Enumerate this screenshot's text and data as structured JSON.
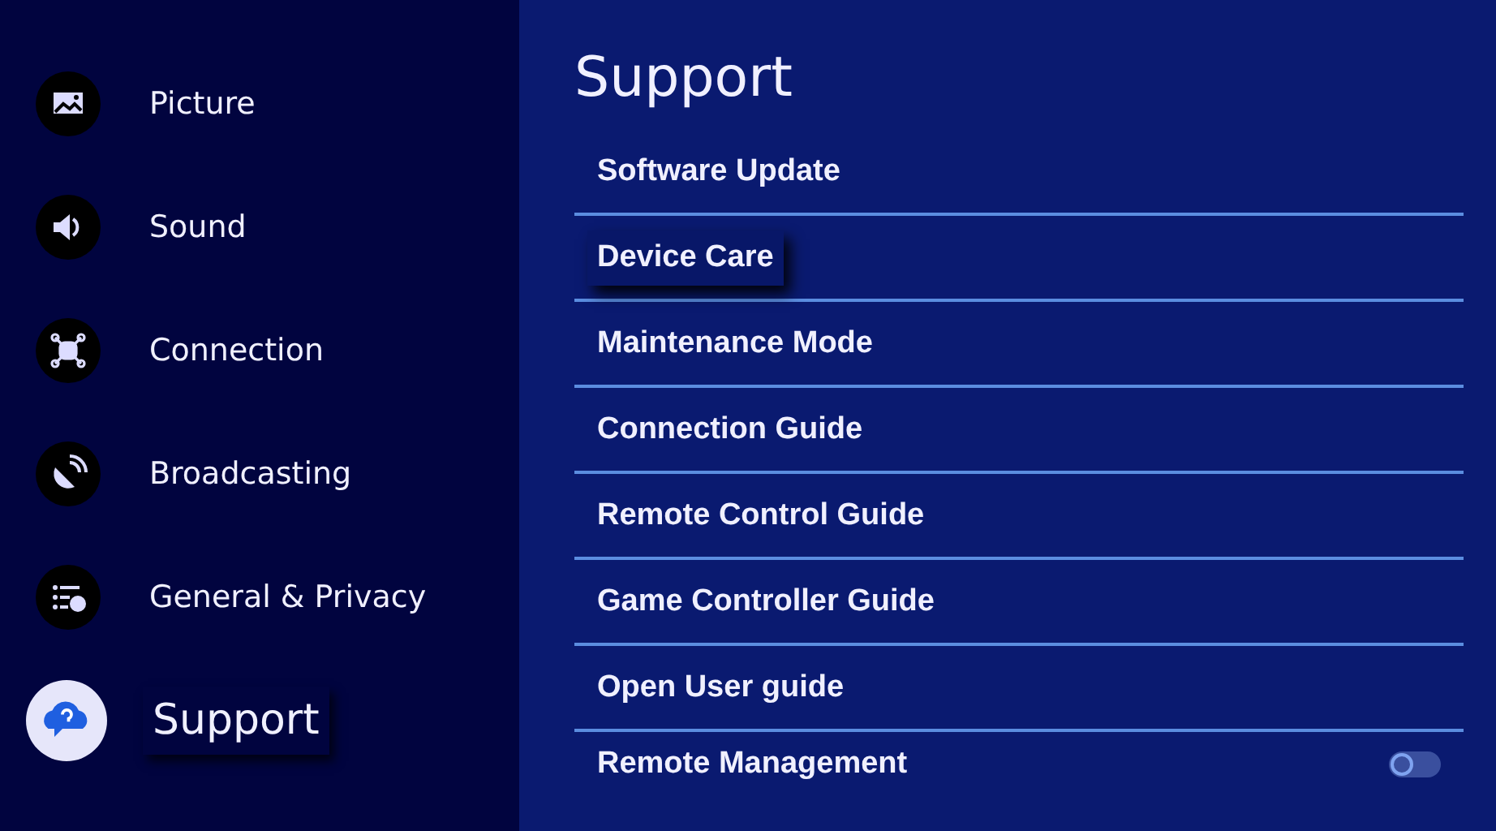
{
  "sidebar": {
    "items": [
      {
        "label": "Picture",
        "selected": false
      },
      {
        "label": "Sound",
        "selected": false
      },
      {
        "label": "Connection",
        "selected": false
      },
      {
        "label": "Broadcasting",
        "selected": false
      },
      {
        "label": "General & Privacy",
        "selected": false
      },
      {
        "label": "Support",
        "selected": true
      }
    ]
  },
  "panel": {
    "title": "Support",
    "items": [
      {
        "label": "Software Update",
        "selected": false
      },
      {
        "label": "Device Care",
        "selected": true
      },
      {
        "label": "Maintenance Mode",
        "selected": false
      },
      {
        "label": "Connection Guide",
        "selected": false
      },
      {
        "label": "Remote Control Guide",
        "selected": false
      },
      {
        "label": "Game Controller Guide",
        "selected": false
      },
      {
        "label": "Open User guide",
        "selected": false
      },
      {
        "label": "Remote Management",
        "selected": false,
        "kind": "toggle",
        "on": false
      }
    ]
  }
}
